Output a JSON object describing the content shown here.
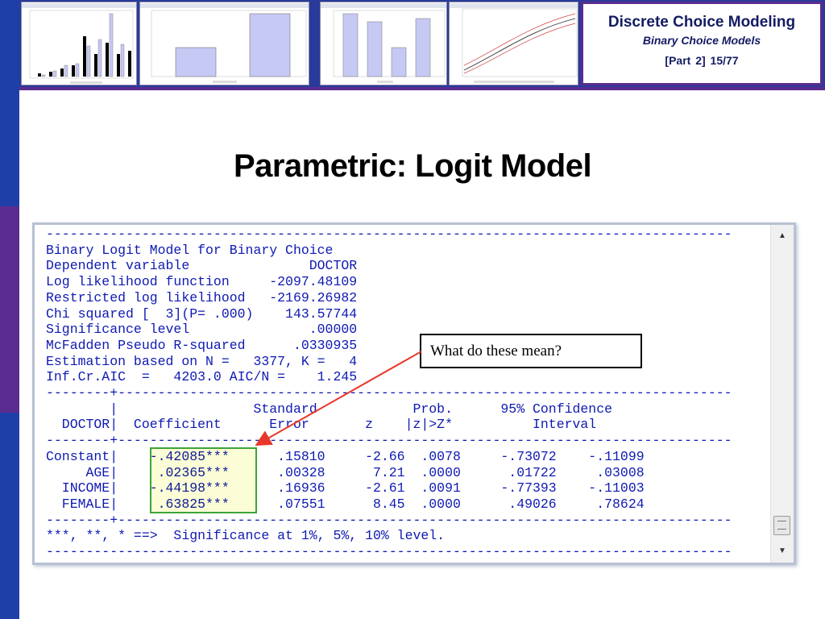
{
  "header": {
    "title": "Discrete Choice Modeling",
    "subtitle": "Binary Choice Models",
    "part": "[Part 2]",
    "page": "15/77"
  },
  "slide": {
    "title": "Parametric: Logit Model"
  },
  "output": {
    "lines": [
      "--------------------------------------------------------------------------------------",
      "Binary Logit Model for Binary Choice",
      "Dependent variable               DOCTOR",
      "Log likelihood function     -2097.48109",
      "Restricted log likelihood   -2169.26982",
      "Chi squared [  3](P= .000)    143.57744",
      "Significance level               .00000",
      "McFadden Pseudo R-squared      .0330935",
      "Estimation based on N =   3377, K =   4",
      "Inf.Cr.AIC  =   4203.0 AIC/N =    1.245",
      "--------+-----------------------------------------------------------------------------",
      "        |                 Standard            Prob.      95% Confidence",
      "  DOCTOR|  Coefficient      Error       z    |z|>Z*          Interval",
      "--------+-----------------------------------------------------------------------------",
      "Constant|    -.42085***      .15810     -2.66  .0078     -.73072    -.11099",
      "     AGE|     .02365***      .00328      7.21  .0000      .01722     .03008",
      "  INCOME|    -.44198***      .16936     -2.61  .0091     -.77393    -.11003",
      "  FEMALE|     .63825***      .07551      8.45  .0000      .49026     .78624",
      "--------+-----------------------------------------------------------------------------",
      "***, **, * ==>  Significance at 1%, 5%, 10% level.",
      "--------------------------------------------------------------------------------------"
    ]
  },
  "callout": {
    "text": "What do these mean?"
  },
  "colors": {
    "navy": "#141b63",
    "purple": "#5b2c8f",
    "output_blue": "#0f1ab1",
    "highlight_fill": "#fbfdd6",
    "highlight_border": "#3da43a",
    "arrow": "#e8372a"
  }
}
